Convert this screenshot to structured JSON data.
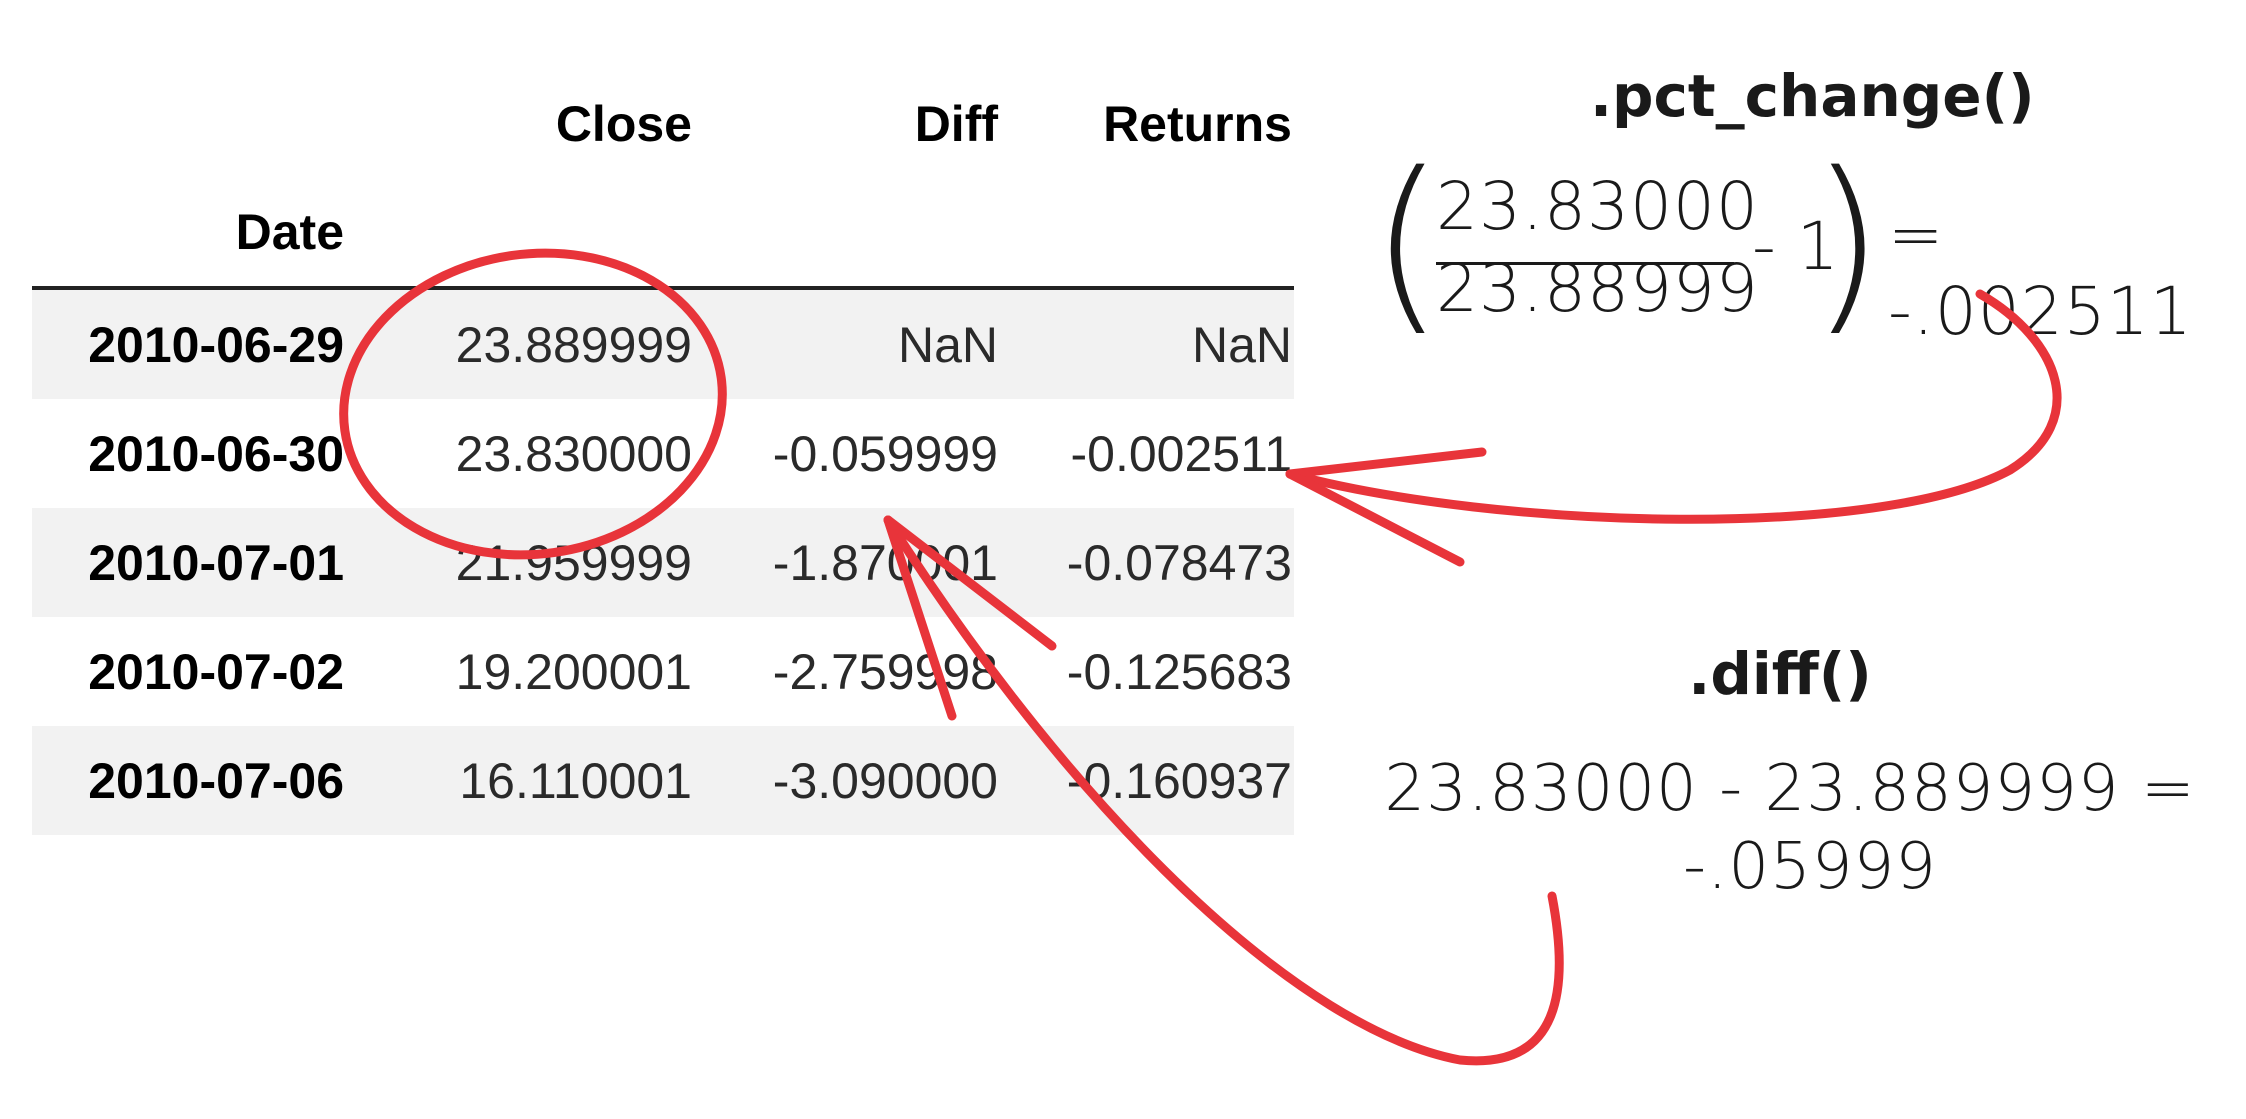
{
  "table": {
    "columns": [
      "Close",
      "Diff",
      "Returns"
    ],
    "index_name": "Date",
    "rows": [
      {
        "date": "2010-06-29",
        "close": "23.889999",
        "diff": "NaN",
        "returns": "NaN"
      },
      {
        "date": "2010-06-30",
        "close": "23.830000",
        "diff": "-0.059999",
        "returns": "-0.002511"
      },
      {
        "date": "2010-07-01",
        "close": "21.959999",
        "diff": "-1.870001",
        "returns": "-0.078473"
      },
      {
        "date": "2010-07-02",
        "close": "19.200001",
        "diff": "-2.759998",
        "returns": "-0.125683"
      },
      {
        "date": "2010-07-06",
        "close": "16.110001",
        "diff": "-3.090000",
        "returns": "-0.160937"
      }
    ]
  },
  "pct_change": {
    "title": ".pct_change()",
    "left_paren": "(",
    "numerator": "23.83000",
    "denominator": "23.88999",
    "minus_one": "- 1",
    "right_paren": ")",
    "result": "= -.002511"
  },
  "diff": {
    "title": ".diff()",
    "equation_line1": "23.83000 - 23.889999 =",
    "equation_line2": "-.05999"
  },
  "annotation_color": "#e8343a"
}
